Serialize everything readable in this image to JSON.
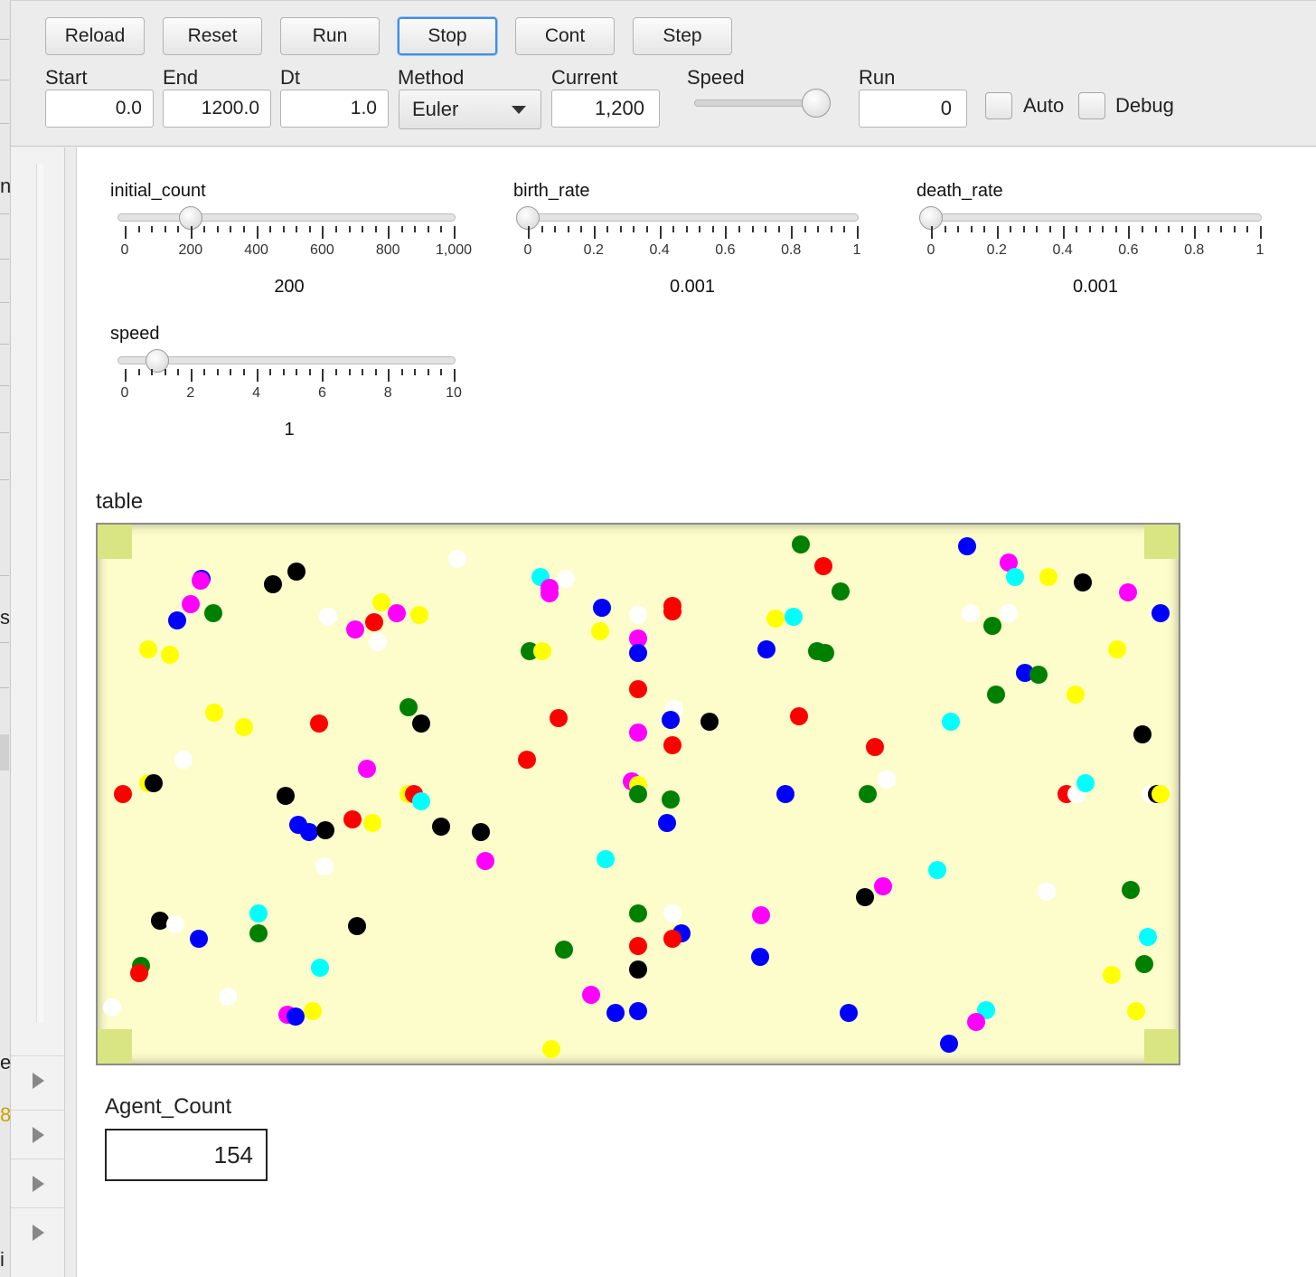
{
  "toolbar": {
    "buttons": [
      "Reload",
      "Reset",
      "Run",
      "Stop",
      "Cont",
      "Step"
    ],
    "start_label": "Start",
    "start_value": "0.0",
    "end_label": "End",
    "end_value": "1200.0",
    "dt_label": "Dt",
    "dt_value": "1.0",
    "method_label": "Method",
    "method_value": "Euler",
    "current_label": "Current",
    "current_value": "1,200",
    "speed_label": "Speed",
    "speed_level": 0.9,
    "run_label": "Run",
    "run_value": "0",
    "auto_label": "Auto",
    "debug_label": "Debug",
    "auto_checked": false,
    "debug_checked": false
  },
  "left_fragments": [
    "n",
    "s",
    "e",
    "8",
    "i"
  ],
  "sliders": [
    {
      "name": "initial_count",
      "value": 200,
      "value_label": "200",
      "min": 0,
      "max": 1000,
      "ticks": [
        "0",
        "200",
        "400",
        "600",
        "800",
        "1,000"
      ]
    },
    {
      "name": "birth_rate",
      "value": 0.001,
      "value_label": "0.001",
      "min": 0,
      "max": 1,
      "ticks": [
        "0",
        "0.2",
        "0.4",
        "0.6",
        "0.8",
        "1"
      ]
    },
    {
      "name": "death_rate",
      "value": 0.001,
      "value_label": "0.001",
      "min": 0,
      "max": 1,
      "ticks": [
        "0",
        "0.2",
        "0.4",
        "0.6",
        "0.8",
        "1"
      ]
    },
    {
      "name": "speed",
      "value": 1,
      "value_label": "1",
      "min": 0,
      "max": 10,
      "ticks": [
        "0",
        "2",
        "4",
        "6",
        "8",
        "10"
      ]
    }
  ],
  "table": {
    "title": "table",
    "colors": {
      "R": "#ff0000",
      "G": "#008000",
      "B": "#0000ff",
      "K": "#000000",
      "W": "#ffffff",
      "Y": "#ffff00",
      "M": "#ff00ff",
      "C": "#00ffff"
    },
    "agents": [
      [
        778,
        22,
        "G"
      ],
      [
        803,
        46,
        "R"
      ],
      [
        822,
        74,
        "G"
      ],
      [
        962,
        24,
        "B"
      ],
      [
        1008,
        42,
        "M"
      ],
      [
        1015,
        58,
        "C"
      ],
      [
        1052,
        58,
        "Y"
      ],
      [
        1090,
        64,
        "K"
      ],
      [
        1140,
        75,
        "M"
      ],
      [
        1176,
        98,
        "B"
      ],
      [
        194,
        66,
        "K"
      ],
      [
        220,
        52,
        "K"
      ],
      [
        398,
        38,
        "W"
      ],
      [
        490,
        58,
        "C"
      ],
      [
        518,
        60,
        "W"
      ],
      [
        500,
        70,
        "M"
      ],
      [
        500,
        76,
        "M"
      ],
      [
        598,
        100,
        "W"
      ],
      [
        636,
        90,
        "R"
      ],
      [
        636,
        96,
        "R"
      ],
      [
        115,
        60,
        "B"
      ],
      [
        114,
        62,
        "M"
      ],
      [
        103,
        88,
        "M"
      ],
      [
        88,
        106,
        "B"
      ],
      [
        128,
        98,
        "G"
      ],
      [
        56,
        138,
        "Y"
      ],
      [
        80,
        144,
        "Y"
      ],
      [
        255,
        102,
        "W"
      ],
      [
        285,
        116,
        "M"
      ],
      [
        306,
        108,
        "R"
      ],
      [
        314,
        86,
        "Y"
      ],
      [
        310,
        130,
        "W"
      ],
      [
        331,
        98,
        "M"
      ],
      [
        356,
        100,
        "Y"
      ],
      [
        558,
        92,
        "B"
      ],
      [
        556,
        118,
        "Y"
      ],
      [
        478,
        140,
        "G"
      ],
      [
        492,
        140,
        "Y"
      ],
      [
        598,
        126,
        "M"
      ],
      [
        598,
        142,
        "B"
      ],
      [
        740,
        138,
        "B"
      ],
      [
        750,
        104,
        "Y"
      ],
      [
        770,
        102,
        "C"
      ],
      [
        796,
        140,
        "G"
      ],
      [
        805,
        142,
        "G"
      ],
      [
        966,
        98,
        "W"
      ],
      [
        990,
        112,
        "G"
      ],
      [
        1008,
        98,
        "W"
      ],
      [
        1026,
        164,
        "B"
      ],
      [
        1041,
        166,
        "G"
      ],
      [
        1128,
        138,
        "Y"
      ],
      [
        129,
        208,
        "Y"
      ],
      [
        162,
        224,
        "Y"
      ],
      [
        344,
        202,
        "G"
      ],
      [
        358,
        220,
        "K"
      ],
      [
        245,
        220,
        "R"
      ],
      [
        510,
        214,
        "R"
      ],
      [
        598,
        182,
        "R"
      ],
      [
        638,
        204,
        "W"
      ],
      [
        634,
        216,
        "B"
      ],
      [
        677,
        218,
        "K"
      ],
      [
        598,
        230,
        "M"
      ],
      [
        636,
        244,
        "R"
      ],
      [
        776,
        212,
        "R"
      ],
      [
        860,
        246,
        "R"
      ],
      [
        944,
        218,
        "C"
      ],
      [
        994,
        188,
        "G"
      ],
      [
        1082,
        188,
        "Y"
      ],
      [
        1156,
        232,
        "K"
      ],
      [
        95,
        260,
        "W"
      ],
      [
        28,
        298,
        "R"
      ],
      [
        56,
        286,
        "Y"
      ],
      [
        62,
        286,
        "K"
      ],
      [
        298,
        270,
        "M"
      ],
      [
        475,
        260,
        "R"
      ],
      [
        208,
        300,
        "K"
      ],
      [
        344,
        298,
        "Y"
      ],
      [
        350,
        298,
        "R"
      ],
      [
        358,
        306,
        "C"
      ],
      [
        591,
        284,
        "M"
      ],
      [
        598,
        288,
        "Y"
      ],
      [
        598,
        298,
        "G"
      ],
      [
        634,
        304,
        "G"
      ],
      [
        630,
        330,
        "B"
      ],
      [
        761,
        298,
        "B"
      ],
      [
        852,
        298,
        "G"
      ],
      [
        873,
        282,
        "W"
      ],
      [
        1072,
        298,
        "R"
      ],
      [
        1083,
        298,
        "W"
      ],
      [
        1093,
        286,
        "C"
      ],
      [
        1165,
        298,
        "W"
      ],
      [
        1172,
        298,
        "K"
      ],
      [
        1176,
        298,
        "Y"
      ],
      [
        222,
        332,
        "B"
      ],
      [
        234,
        340,
        "B"
      ],
      [
        252,
        338,
        "K"
      ],
      [
        282,
        326,
        "R"
      ],
      [
        304,
        330,
        "Y"
      ],
      [
        380,
        334,
        "K"
      ],
      [
        424,
        340,
        "K"
      ],
      [
        251,
        378,
        "W"
      ],
      [
        429,
        372,
        "M"
      ],
      [
        562,
        370,
        "C"
      ],
      [
        849,
        412,
        "K"
      ],
      [
        869,
        400,
        "M"
      ],
      [
        929,
        382,
        "C"
      ],
      [
        1050,
        406,
        "W"
      ],
      [
        1143,
        404,
        "G"
      ],
      [
        69,
        438,
        "K"
      ],
      [
        86,
        442,
        "W"
      ],
      [
        112,
        458,
        "B"
      ],
      [
        178,
        430,
        "C"
      ],
      [
        178,
        452,
        "G"
      ],
      [
        287,
        444,
        "K"
      ],
      [
        48,
        488,
        "G"
      ],
      [
        46,
        496,
        "R"
      ],
      [
        246,
        490,
        "C"
      ],
      [
        516,
        470,
        "G"
      ],
      [
        598,
        430,
        "G"
      ],
      [
        636,
        430,
        "W"
      ],
      [
        646,
        452,
        "B"
      ],
      [
        636,
        458,
        "R"
      ],
      [
        598,
        466,
        "R"
      ],
      [
        734,
        432,
        "M"
      ],
      [
        733,
        478,
        "B"
      ],
      [
        1162,
        456,
        "C"
      ],
      [
        1158,
        486,
        "G"
      ],
      [
        1122,
        498,
        "Y"
      ],
      [
        598,
        492,
        "K"
      ],
      [
        16,
        534,
        "W"
      ],
      [
        144,
        522,
        "W"
      ],
      [
        210,
        542,
        "M"
      ],
      [
        219,
        544,
        "B"
      ],
      [
        238,
        538,
        "Y"
      ],
      [
        546,
        520,
        "M"
      ],
      [
        573,
        540,
        "B"
      ],
      [
        598,
        538,
        "B"
      ],
      [
        831,
        540,
        "B"
      ],
      [
        983,
        537,
        "C"
      ],
      [
        972,
        550,
        "M"
      ],
      [
        1149,
        538,
        "Y"
      ],
      [
        942,
        574,
        "B"
      ],
      [
        502,
        580,
        "Y"
      ]
    ]
  },
  "agent_count": {
    "title": "Agent_Count",
    "value": "154"
  }
}
